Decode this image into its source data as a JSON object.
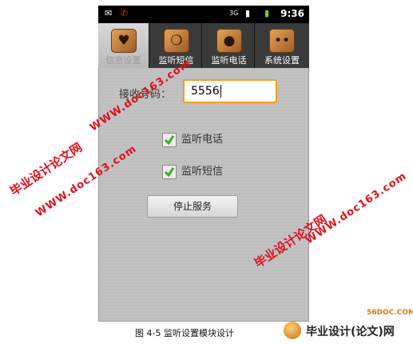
{
  "statusbar": {
    "network": "3G",
    "time": "9:36"
  },
  "tabs": [
    {
      "label": "信息设置",
      "icon": "heart-icon",
      "active": true
    },
    {
      "label": "监听短信",
      "icon": "chat-bubble-icon",
      "active": false
    },
    {
      "label": "监听电话",
      "icon": "person-icon",
      "active": false
    },
    {
      "label": "系统设置",
      "icon": "dots-icon",
      "active": false
    }
  ],
  "form": {
    "receive_label": "接收号码：",
    "receive_value": "5556",
    "cb_phone_label": "监听电话",
    "cb_phone_checked": true,
    "cb_sms_label": "监听短信",
    "cb_sms_checked": true,
    "stop_button": "停止服务"
  },
  "watermark": {
    "cn": "毕业设计论文网",
    "url": "WWW.doc163.com"
  },
  "caption": "图 4-5 监听设置模块设计",
  "logo": {
    "text": "毕业设计(论文)网",
    "site": "56DOC.COM"
  },
  "colors": {
    "accent": "#f59b20",
    "watermark": "#e0101c"
  }
}
